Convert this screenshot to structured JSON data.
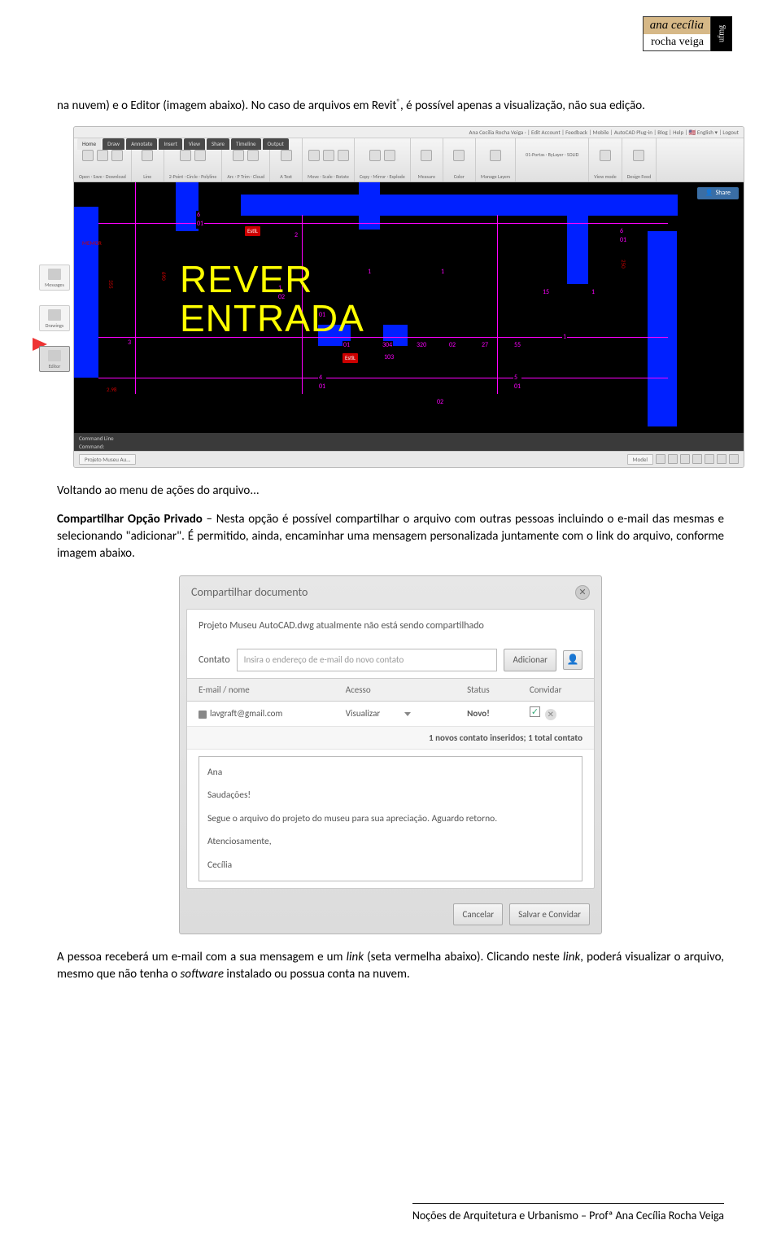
{
  "logo": {
    "name_top": "ana cecília",
    "name_bottom": "rocha veiga",
    "right": "ufmg"
  },
  "para1_a": "na nuvem) e o Editor (imagem abaixo). No caso de arquivos em Revit",
  "para1_sup": "®",
  "para1_b": ", é possível apenas a visualização, não sua edição.",
  "cad": {
    "topbar": "Ana Cecília Rocha Veiga · | Edit Account | Feedback | Mobile | AutoCAD Plug-in | Blog | Help | 🇺🇸 English ▾ | Logout",
    "tabs": [
      "Home",
      "Draw",
      "Annotate",
      "Insert",
      "View",
      "Share",
      "Timeline",
      "Output"
    ],
    "groups": [
      {
        "icons": 2,
        "label": "Open · Save · Download"
      },
      {
        "icons": 3,
        "label": "Line"
      },
      {
        "icons": 3,
        "label": "2-Point · Circle · Polyline"
      },
      {
        "icons": 3,
        "label": "Arc · P Trim · Cloud"
      },
      {
        "icons": 1,
        "label": "A Text"
      },
      {
        "icons": 3,
        "label": "Move · Scale · Rotate"
      },
      {
        "icons": 2,
        "label": "Copy · Mirror · Explode"
      },
      {
        "icons": 1,
        "label": "Measure"
      },
      {
        "icons": 1,
        "label": "Color"
      },
      {
        "icons": 1,
        "label": "Manage Layers"
      },
      {
        "icons": 2,
        "label": "01-Portas · ByLayer · SOLID"
      },
      {
        "icons": 1,
        "label": "View mode"
      },
      {
        "icons": 1,
        "label": "Design Feed"
      }
    ],
    "sidebar": [
      "Messages",
      "Drawings",
      "Editor"
    ],
    "big_text_1": "REVER",
    "big_text_2": "ENTRADA",
    "red_tags": [
      "EstiL",
      "EstiL"
    ],
    "cmd_label": "Command Line",
    "cmd_prompt": "Command:",
    "status_tab1": "Projeto Museu Au...",
    "status_tab2": "Model",
    "share": "Share",
    "memor": "MEMOR"
  },
  "para2": "Voltando ao menu de ações do arquivo...",
  "para3_bold": "Compartilhar Opção Privado",
  "para3_rest": " – Nesta opção é possível compartilhar o arquivo com outras pessoas incluindo o e-mail das mesmas e selecionando \"adicionar\". É permitido, ainda, encaminhar uma mensagem personalizada juntamente com o link do arquivo, conforme imagem abaixo.",
  "dialog": {
    "title": "Compartilhar documento",
    "info": "Projeto Museu AutoCAD.dwg atualmente não está sendo compartilhado",
    "contact_label": "Contato",
    "contact_placeholder": "Insira o endereço de e-mail do novo contato",
    "add_btn": "Adicionar",
    "headers": [
      "E-mail / nome",
      "Acesso",
      "Status",
      "Convidar"
    ],
    "row": {
      "email": "lavgraft@gmail.com",
      "access": "Visualizar",
      "status": "Novo!"
    },
    "count_a": "1 novos contato inseridos; ",
    "count_b": "1 total contato",
    "msg": {
      "l1": "Ana",
      "l2": "Saudações!",
      "l3": "Segue o arquivo do projeto do museu para sua apreciação. Aguardo retorno.",
      "l4": "Atenciosamente,",
      "l5": "Cecília"
    },
    "cancel": "Cancelar",
    "save": "Salvar e Convidar"
  },
  "para4_a": "A pessoa receberá um e-mail com a sua mensagem e um ",
  "para4_link1": "link",
  "para4_b": " (seta vermelha abaixo). Clicando neste ",
  "para4_link2": "link",
  "para4_c": ", poderá visualizar o arquivo, mesmo que não tenha o ",
  "para4_sw": "software",
  "para4_d": " instalado ou possua conta na nuvem.",
  "footer": "Noções de Arquitetura e Urbanismo – Profª Ana Cecília Rocha Veiga"
}
